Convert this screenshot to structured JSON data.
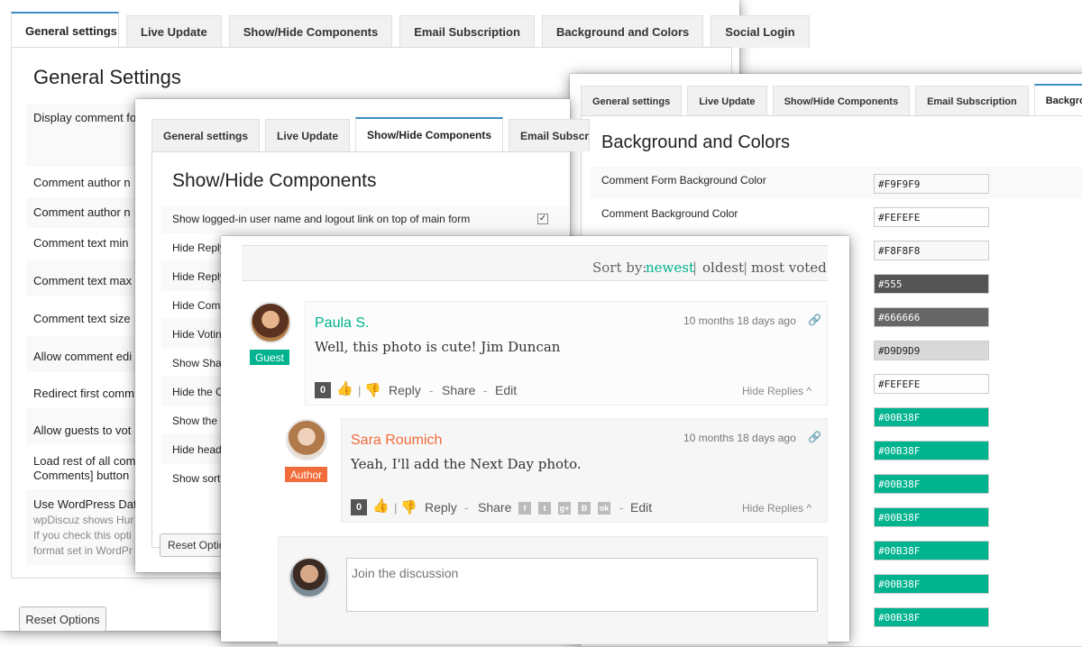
{
  "general": {
    "tabs": [
      "General settings",
      "Live Update",
      "Show/Hide Components",
      "Email Subscription",
      "Background and Colors",
      "Social Login"
    ],
    "title": "General Settings",
    "rows": [
      "Display comment fo",
      "Comment author n",
      "Comment author n",
      "Comment text min",
      "Comment text max",
      "Comment text size",
      "Allow comment edi",
      "Redirect first comm",
      "Allow guests to vot",
      "Load rest of all com",
      "Comments] button",
      "Use WordPress Dat",
      "wpDiscuz shows Hur",
      "If you check this opti",
      "format set in WordPr"
    ],
    "reset": "Reset Options"
  },
  "showhide": {
    "tabs": [
      "General settings",
      "Live Update",
      "Show/Hide Components",
      "Email Subscrip"
    ],
    "title": "Show/Hide Components",
    "rows": [
      "Show logged-in user name and logout link on top of main form",
      "Hide Reply",
      "Hide Reply",
      "Hide Com",
      "Hide Votin",
      "Show Sha",
      "Hide the C",
      "Show the",
      "Hide head",
      "Show sort"
    ],
    "reset": "Reset Optio"
  },
  "colors": {
    "tabs": [
      "General settings",
      "Live Update",
      "Show/Hide Components",
      "Email Subscription",
      "Background an"
    ],
    "title": "Background and Colors",
    "labels": [
      "Comment Form Background Color",
      "Comment Background Color"
    ],
    "swatches": [
      {
        "value": "#F9F9F9",
        "bg": "#F9F9F9",
        "dark": false
      },
      {
        "value": "#FEFEFE",
        "bg": "#FEFEFE",
        "dark": false
      },
      {
        "value": "#F8F8F8",
        "bg": "#F8F8F8",
        "dark": false
      },
      {
        "value": "#555",
        "bg": "#555555",
        "dark": true
      },
      {
        "value": "#666666",
        "bg": "#666666",
        "dark": true
      },
      {
        "value": "#D9D9D9",
        "bg": "#D9D9D9",
        "dark": false
      },
      {
        "value": "#FEFEFE",
        "bg": "#FEFEFE",
        "dark": false
      },
      {
        "value": "#00B38F",
        "bg": "#00B38F",
        "dark": true
      },
      {
        "value": "#00B38F",
        "bg": "#00B38F",
        "dark": true
      },
      {
        "value": "#00B38F",
        "bg": "#00B38F",
        "dark": true
      },
      {
        "value": "#00B38F",
        "bg": "#00B38F",
        "dark": true
      },
      {
        "value": "#00B38F",
        "bg": "#00B38F",
        "dark": true
      },
      {
        "value": "#00B38F",
        "bg": "#00B38F",
        "dark": true
      },
      {
        "value": "#00B38F",
        "bg": "#00B38F",
        "dark": true
      }
    ]
  },
  "comments": {
    "sort_label": "Sort by:",
    "sort_newest": "newest",
    "sort_oldest": "oldest",
    "sort_voted": "most voted",
    "sep": "|",
    "accent": "#00B38F",
    "author_color": "#F26B3A",
    "c1": {
      "name": "Paula S.",
      "badge": "Guest",
      "date": "10 months 18 days ago",
      "text": "Well, this photo is cute! Jim Duncan",
      "votes": "0",
      "reply": "Reply",
      "share": "Share",
      "edit": "Edit",
      "hide": "Hide Replies ^"
    },
    "c2": {
      "name": "Sara Roumich",
      "badge": "Author",
      "date": "10 months 18 days ago",
      "text": "Yeah, I'll add the Next Day photo.",
      "votes": "0",
      "reply": "Reply",
      "share": "Share",
      "edit": "Edit",
      "hide": "Hide Replies ^"
    },
    "dash": "-",
    "social_icons": [
      "facebook-icon",
      "twitter-icon",
      "googleplus-icon",
      "vk-icon",
      "ok-icon"
    ],
    "social_glyphs": [
      "f",
      "t",
      "g+",
      "B",
      "ok"
    ],
    "placeholder": "Join the discussion"
  }
}
